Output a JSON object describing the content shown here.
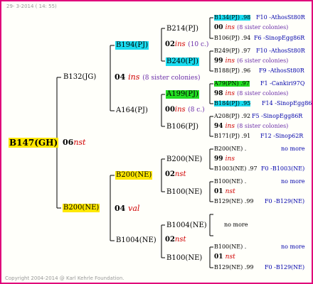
{
  "date": "29- 3-2014 ( 14: 55)",
  "copyright": "Copyright 2004-2014 @ Karl Kehrle Foundation.",
  "root": {
    "name": "B147(GH)",
    "year": "06",
    "place": "nst"
  },
  "g1": [
    {
      "name": "B132(JG)",
      "year": "04",
      "place": "ins",
      "note": "(8 sister colonies)"
    },
    {
      "name": "B200(NE)",
      "year": "04",
      "place": "val"
    }
  ],
  "g2": [
    {
      "name": "B194(PJ)",
      "year": "02",
      "place": "ins",
      "note": "(10 c.)"
    },
    {
      "name": "A164(PJ)",
      "year": "00",
      "place": "ins",
      "note": "(8 c.)"
    },
    {
      "name": "B200(NE)",
      "year": "02",
      "place": "nst"
    },
    {
      "name": "B1004(NE)",
      "year": "02",
      "place": "nst"
    }
  ],
  "g3": [
    {
      "name": "B214(PJ)"
    },
    {
      "name": "B240(PJ)"
    },
    {
      "name": "A199(PJ)"
    },
    {
      "name": "B106(PJ)"
    },
    {
      "name": "B200(NE)"
    },
    {
      "name": "B100(NE)"
    },
    {
      "name": "B1004(NE)"
    },
    {
      "name": "B100(NE)"
    }
  ],
  "g4": [
    {
      "top": "B134(PJ) .98",
      "top_info": "F10 -AthosSt80R",
      "year": "00",
      "place": "ins",
      "note": "(8 sister colonies)",
      "bottom": "B106(PJ) .94",
      "bottom_info": "F6 -SinopEgg86R"
    },
    {
      "top": "B249(PJ) .97",
      "top_info": "F10 -AthosSt80R",
      "year": "99",
      "place": "ins",
      "note": "(6 sister colonies)",
      "bottom": "B188(PJ) .96",
      "bottom_info": "F9 -AthosSt80R"
    },
    {
      "top": "A79(PN) .97",
      "top_info": "F1 -Cankiri97Q",
      "year": "98",
      "place": "ins",
      "note": "(8 sister colonies)",
      "bottom": "B184(PJ) .95",
      "bottom_info": "F14 -SinopEgg86R"
    },
    {
      "top": "A208(PJ) .92",
      "top_info": "F5 -SinopEgg86R",
      "year": "94",
      "place": "ins",
      "note": "(8 sister colonies)",
      "bottom": "B171(PJ) .91",
      "bottom_info": "F12 -Sinop62R"
    },
    {
      "top": "B200(NE) .",
      "top_info": "no more",
      "year": "99",
      "place": "ins",
      "note": "",
      "bottom": "B1003(NE) .97",
      "bottom_info": "F0 -B1003(NE)"
    },
    {
      "top": "B100(NE) .",
      "top_info": "no more",
      "year": "01",
      "place": "nst",
      "note": "",
      "bottom": "B129(NE) .99",
      "bottom_info": "F0 -B129(NE)"
    },
    {
      "single": "no more"
    },
    {
      "top": "B100(NE) .",
      "top_info": "no more",
      "year": "01",
      "place": "nst",
      "note": "",
      "bottom": "B129(NE) .99",
      "bottom_info": "F0 -B129(NE)"
    }
  ],
  "colors": {
    "border": "#e0007a",
    "gold": "#ffe800",
    "cyan": "#19dcf0",
    "green": "#22dd22",
    "red": "#d00000",
    "note": "#6a2ca8",
    "blue": "#0000aa"
  }
}
